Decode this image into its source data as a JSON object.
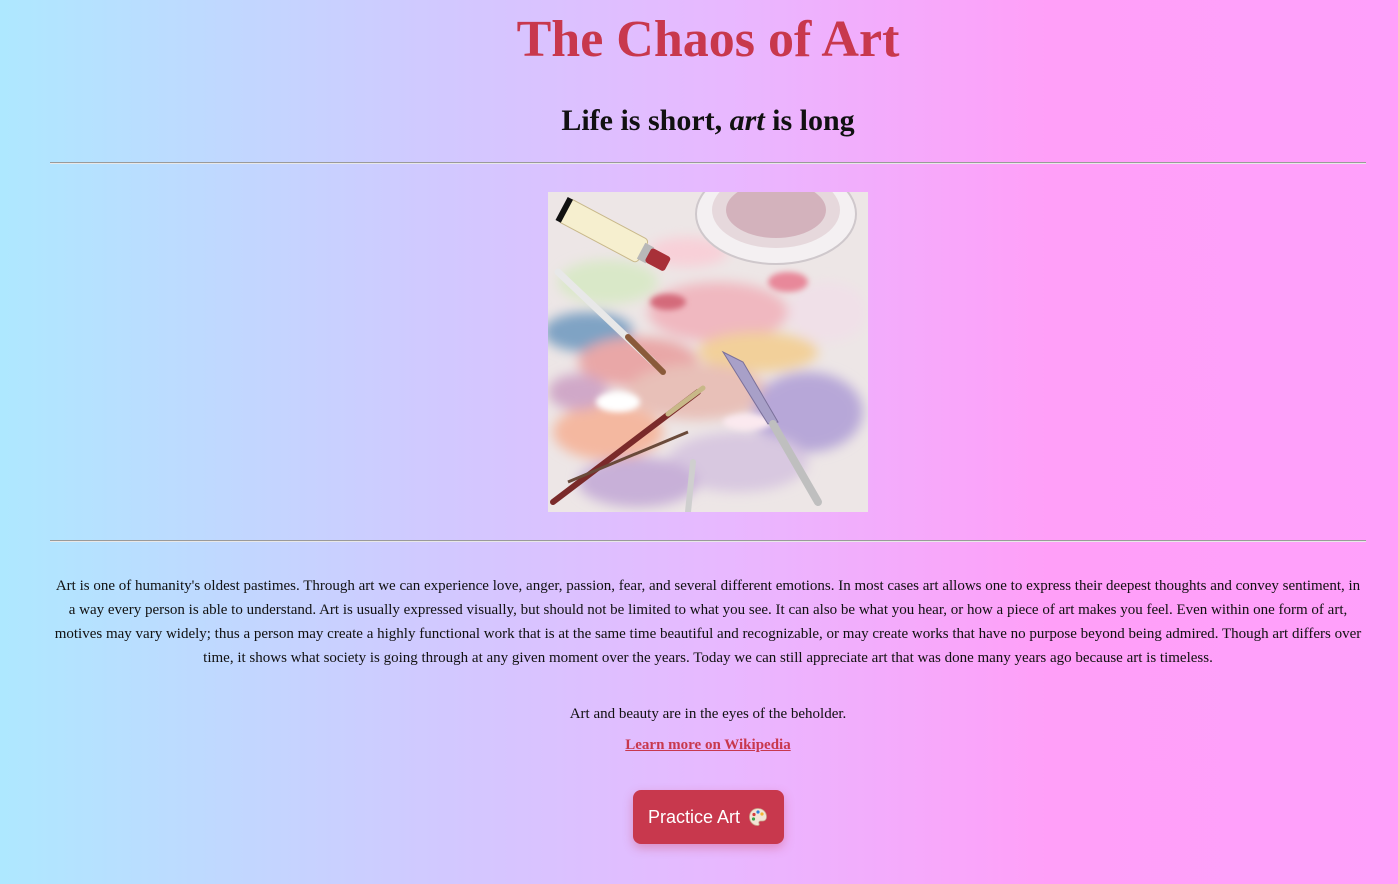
{
  "page": {
    "title": "The Chaos of Art",
    "subtitle_pre": "Life is short, ",
    "subtitle_em": "art",
    "subtitle_post": " is long",
    "image_alt": "Palette with paint, brushes and tube",
    "paragraph": "Art is one of humanity's oldest pastimes. Through art we can experience love, anger, passion, fear, and several different emotions. In most cases art allows one to express their deepest thoughts and convey sentiment, in a way every person is able to understand. Art is usually expressed visually, but should not be limited to what you see. It can also be what you hear, or how a piece of art makes you feel. Even within one form of art, motives may vary widely; thus a person may create a highly functional work that is at the same time beautiful and recognizable, or may create works that have no purpose beyond being admired. Though art differs over time, it shows what society is going through at any given moment over the years. Today we can still appreciate art that was done many years ago because art is timeless.",
    "quote": "Art and beauty are in the eyes of the beholder.",
    "link_label": "Learn more on Wikipedia",
    "button_label": "Practice Art",
    "button_icon": "palette-icon"
  },
  "colors": {
    "accent": "#c8384d",
    "bg_left": "#aee8ff",
    "bg_right": "#ffa0fb"
  }
}
